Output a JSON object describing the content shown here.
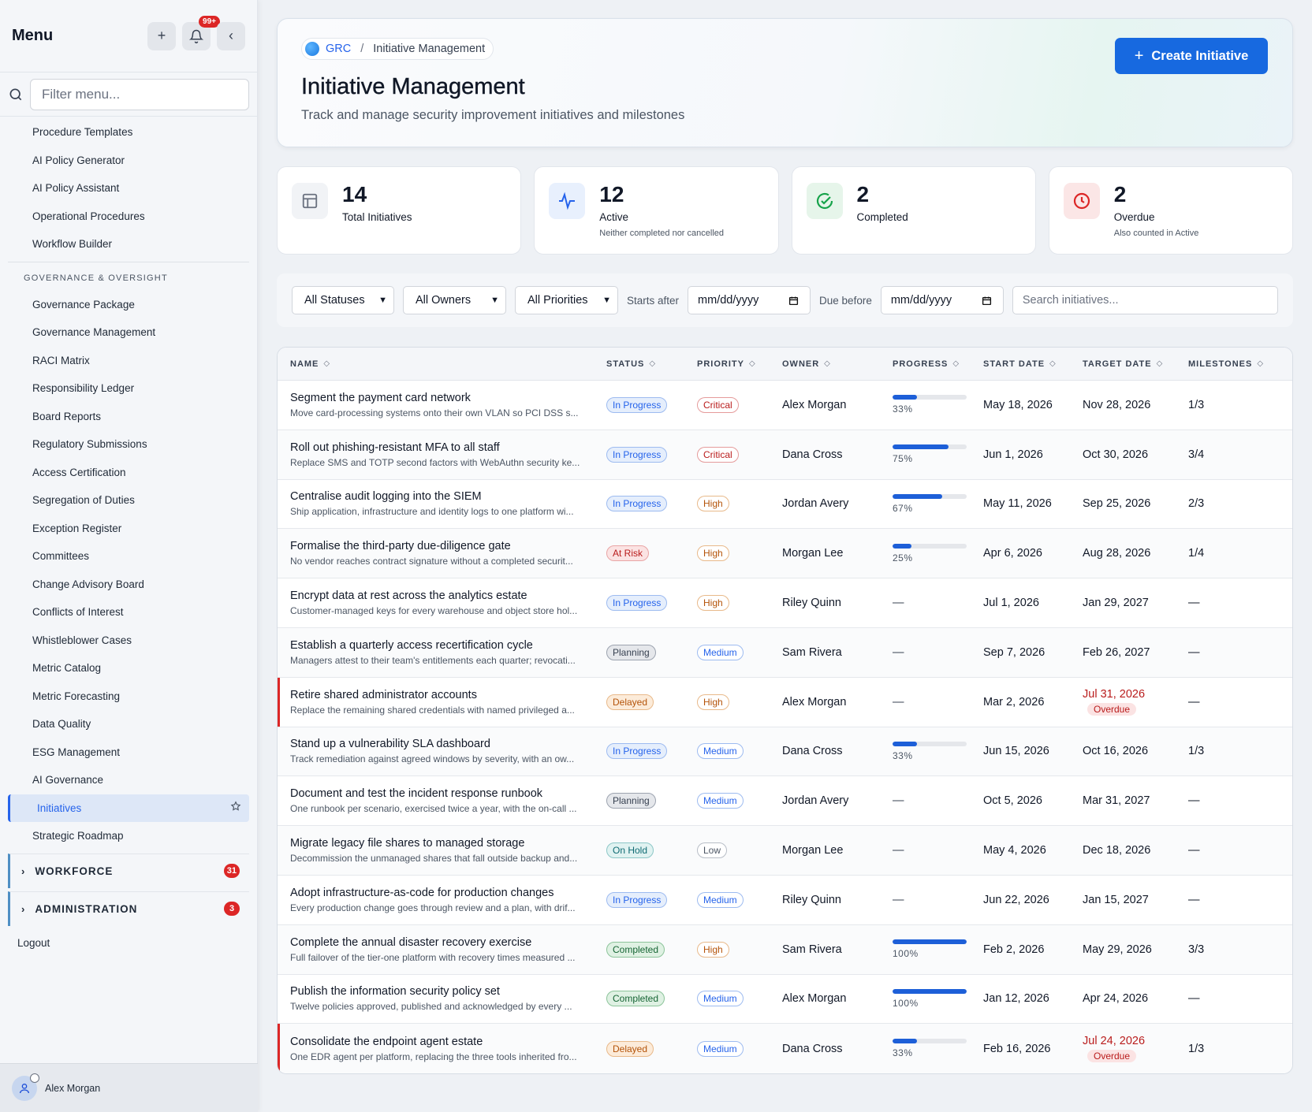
{
  "sidebar": {
    "title": "Menu",
    "notif_count": "99+",
    "filter_placeholder": "Filter menu...",
    "items_top": [
      "Procedure Templates",
      "AI Policy Generator",
      "AI Policy Assistant",
      "Operational Procedures",
      "Workflow Builder"
    ],
    "section": "GOVERNANCE & OVERSIGHT",
    "items_gov": [
      "Governance Package",
      "Governance Management",
      "RACI Matrix",
      "Responsibility Ledger",
      "Board Reports",
      "Regulatory Submissions",
      "Access Certification",
      "Segregation of Duties",
      "Exception Register",
      "Committees",
      "Change Advisory Board",
      "Conflicts of Interest",
      "Whistleblower Cases",
      "Metric Catalog",
      "Metric Forecasting",
      "Data Quality",
      "ESG Management",
      "AI Governance"
    ],
    "active_item": "Initiatives",
    "after_active": "Strategic Roadmap",
    "groups": [
      {
        "label": "WORKFORCE",
        "count": "31"
      },
      {
        "label": "ADMINISTRATION",
        "count": "3"
      }
    ],
    "logout": "Logout",
    "user": "Alex Morgan"
  },
  "header": {
    "crumb_root": "GRC",
    "crumb_sep": "/",
    "crumb_current": "Initiative Management",
    "title": "Initiative Management",
    "subtitle": "Track and manage security improvement initiatives and milestones",
    "create_label": "Create Initiative"
  },
  "stats": [
    {
      "num": "14",
      "label": "Total Initiatives",
      "sub": "",
      "icon": "table-icon",
      "color": "#6b7280"
    },
    {
      "num": "12",
      "label": "Active",
      "sub": "Neither completed nor cancelled",
      "icon": "activity-icon",
      "color": "#2563eb"
    },
    {
      "num": "2",
      "label": "Completed",
      "sub": "",
      "icon": "check-circle-icon",
      "color": "#16a34a"
    },
    {
      "num": "2",
      "label": "Overdue",
      "sub": "Also counted in Active",
      "icon": "clock-icon",
      "color": "#dc2626"
    }
  ],
  "filters": {
    "status": "All Statuses",
    "owner": "All Owners",
    "priority": "All Priorities",
    "starts_after_label": "Starts after",
    "due_before_label": "Due before",
    "date_placeholder": "mm/dd/yyyy",
    "search_placeholder": "Search initiatives..."
  },
  "table": {
    "columns": [
      "NAME",
      "STATUS",
      "PRIORITY",
      "OWNER",
      "PROGRESS",
      "START DATE",
      "TARGET DATE",
      "MILESTONES"
    ],
    "rows": [
      {
        "name": "Segment the payment card network",
        "desc": "Move card-processing systems onto their own VLAN so PCI DSS s...",
        "status": "In Progress",
        "priority": "Critical",
        "owner": "Alex Morgan",
        "progress": 33,
        "progress_text": "33%",
        "start": "May 18, 2026",
        "target": "Nov 28, 2026",
        "overdue": "",
        "milestones": "1/3"
      },
      {
        "name": "Roll out phishing-resistant MFA to all staff",
        "desc": "Replace SMS and TOTP second factors with WebAuthn security ke...",
        "status": "In Progress",
        "priority": "Critical",
        "owner": "Dana Cross",
        "progress": 75,
        "progress_text": "75%",
        "start": "Jun 1, 2026",
        "target": "Oct 30, 2026",
        "overdue": "",
        "milestones": "3/4"
      },
      {
        "name": "Centralise audit logging into the SIEM",
        "desc": "Ship application, infrastructure and identity logs to one platform wi...",
        "status": "In Progress",
        "priority": "High",
        "owner": "Jordan Avery",
        "progress": 67,
        "progress_text": "67%",
        "start": "May 11, 2026",
        "target": "Sep 25, 2026",
        "overdue": "",
        "milestones": "2/3"
      },
      {
        "name": "Formalise the third-party due-diligence gate",
        "desc": "No vendor reaches contract signature without a completed securit...",
        "status": "At Risk",
        "priority": "High",
        "owner": "Morgan Lee",
        "progress": 25,
        "progress_text": "25%",
        "start": "Apr 6, 2026",
        "target": "Aug 28, 2026",
        "overdue": "",
        "milestones": "1/4"
      },
      {
        "name": "Encrypt data at rest across the analytics estate",
        "desc": "Customer-managed keys for every warehouse and object store hol...",
        "status": "In Progress",
        "priority": "High",
        "owner": "Riley Quinn",
        "progress": null,
        "progress_text": "—",
        "start": "Jul 1, 2026",
        "target": "Jan 29, 2027",
        "overdue": "",
        "milestones": "—"
      },
      {
        "name": "Establish a quarterly access recertification cycle",
        "desc": "Managers attest to their team's entitlements each quarter; revocati...",
        "status": "Planning",
        "priority": "Medium",
        "owner": "Sam Rivera",
        "progress": null,
        "progress_text": "—",
        "start": "Sep 7, 2026",
        "target": "Feb 26, 2027",
        "overdue": "",
        "milestones": "—"
      },
      {
        "name": "Retire shared administrator accounts",
        "desc": "Replace the remaining shared credentials with named privileged a...",
        "status": "Delayed",
        "priority": "High",
        "owner": "Alex Morgan",
        "progress": null,
        "progress_text": "—",
        "start": "Mar 2, 2026",
        "target": "Jul 31, 2026",
        "overdue": "Overdue",
        "milestones": "—"
      },
      {
        "name": "Stand up a vulnerability SLA dashboard",
        "desc": "Track remediation against agreed windows by severity, with an ow...",
        "status": "In Progress",
        "priority": "Medium",
        "owner": "Dana Cross",
        "progress": 33,
        "progress_text": "33%",
        "start": "Jun 15, 2026",
        "target": "Oct 16, 2026",
        "overdue": "",
        "milestones": "1/3"
      },
      {
        "name": "Document and test the incident response runbook",
        "desc": "One runbook per scenario, exercised twice a year, with the on-call ...",
        "status": "Planning",
        "priority": "Medium",
        "owner": "Jordan Avery",
        "progress": null,
        "progress_text": "—",
        "start": "Oct 5, 2026",
        "target": "Mar 31, 2027",
        "overdue": "",
        "milestones": "—"
      },
      {
        "name": "Migrate legacy file shares to managed storage",
        "desc": "Decommission the unmanaged shares that fall outside backup and...",
        "status": "On Hold",
        "priority": "Low",
        "owner": "Morgan Lee",
        "progress": null,
        "progress_text": "—",
        "start": "May 4, 2026",
        "target": "Dec 18, 2026",
        "overdue": "",
        "milestones": "—"
      },
      {
        "name": "Adopt infrastructure-as-code for production changes",
        "desc": "Every production change goes through review and a plan, with drif...",
        "status": "In Progress",
        "priority": "Medium",
        "owner": "Riley Quinn",
        "progress": null,
        "progress_text": "—",
        "start": "Jun 22, 2026",
        "target": "Jan 15, 2027",
        "overdue": "",
        "milestones": "—"
      },
      {
        "name": "Complete the annual disaster recovery exercise",
        "desc": "Full failover of the tier-one platform with recovery times measured ...",
        "status": "Completed",
        "priority": "High",
        "owner": "Sam Rivera",
        "progress": 100,
        "progress_text": "100%",
        "start": "Feb 2, 2026",
        "target": "May 29, 2026",
        "overdue": "",
        "milestones": "3/3"
      },
      {
        "name": "Publish the information security policy set",
        "desc": "Twelve policies approved, published and acknowledged by every ...",
        "status": "Completed",
        "priority": "Medium",
        "owner": "Alex Morgan",
        "progress": 100,
        "progress_text": "100%",
        "start": "Jan 12, 2026",
        "target": "Apr 24, 2026",
        "overdue": "",
        "milestones": "—"
      },
      {
        "name": "Consolidate the endpoint agent estate",
        "desc": "One EDR agent per platform, replacing the three tools inherited fro...",
        "status": "Delayed",
        "priority": "Medium",
        "owner": "Dana Cross",
        "progress": 33,
        "progress_text": "33%",
        "start": "Feb 16, 2026",
        "target": "Jul 24, 2026",
        "overdue": "Overdue",
        "milestones": "1/3"
      }
    ]
  },
  "colors": {
    "accent": "#1769e0",
    "danger": "#dc2626",
    "success": "#16a34a"
  }
}
